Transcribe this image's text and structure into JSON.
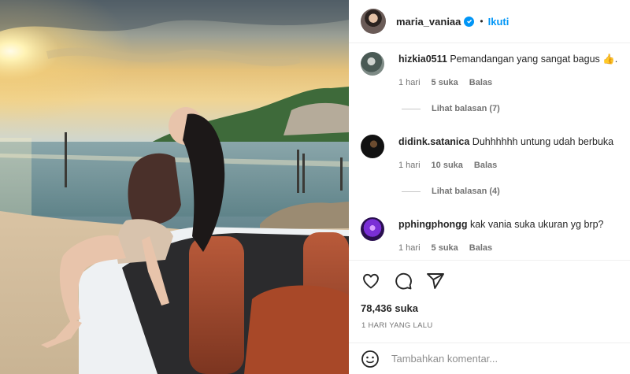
{
  "post": {
    "author": "maria_vaniaa",
    "follow_label": "Ikuti",
    "dot": "•"
  },
  "comments": [
    {
      "user": "hizkia0511",
      "text": "Pemandangan yang sangat bagus 👍.",
      "time": "1 hari",
      "likes": "5 suka",
      "reply_label": "Balas",
      "view_replies": "Lihat balasan (7)"
    },
    {
      "user": "didink.satanica",
      "text": "Duhhhhhh untung udah berbuka",
      "time": "1 hari",
      "likes": "10 suka",
      "reply_label": "Balas",
      "view_replies": "Lihat balasan (4)"
    },
    {
      "user": "pphingphongg",
      "text": "kak vania suka ukuran yg brp?",
      "time": "1 hari",
      "likes": "5 suka",
      "reply_label": "Balas"
    }
  ],
  "stats": {
    "likes": "78,436 suka",
    "posted": "1 HARI YANG LALU"
  },
  "add_comment": {
    "placeholder": "Tambahkan komentar..."
  },
  "icons": [
    "heart-icon",
    "comment-icon",
    "share-icon",
    "emoji-icon",
    "verified-icon"
  ]
}
